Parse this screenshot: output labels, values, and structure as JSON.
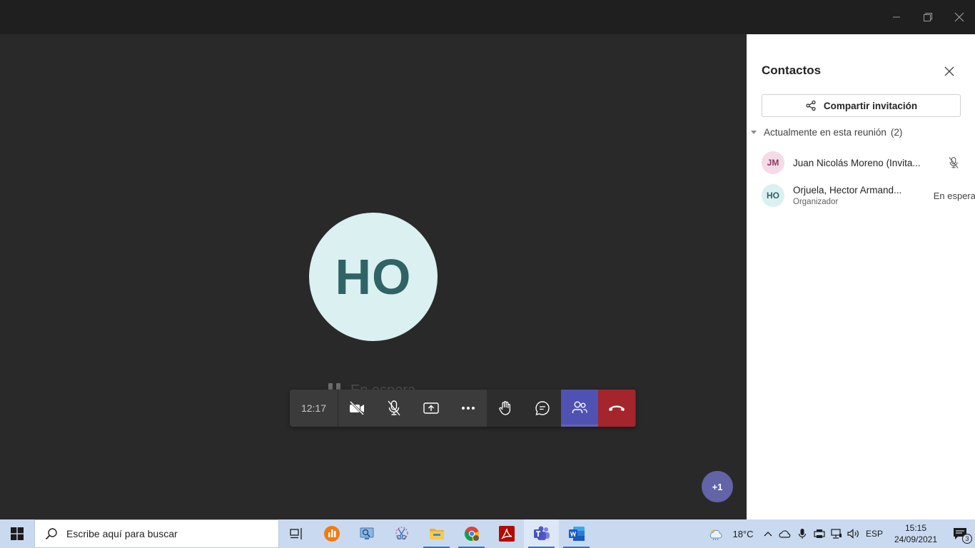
{
  "window": {
    "minimize_icon": "minimize-icon",
    "restore_icon": "restore-icon",
    "close_icon": "close-icon"
  },
  "stage": {
    "avatar_initials": "HO",
    "status_text": "En espera",
    "overflow_badge": "+1"
  },
  "toolbar": {
    "timer": "12:17",
    "buttons": [
      "camera-off-icon",
      "mic-off-icon",
      "share-screen-icon",
      "more-icon",
      "raise-hand-icon",
      "chat-icon",
      "participants-icon",
      "hang-up-icon"
    ]
  },
  "panel": {
    "title": "Contactos",
    "share_label": "Compartir invitación",
    "section_label": "Actualmente en esta reunión",
    "section_count": "(2)",
    "participants": [
      {
        "initials": "JM",
        "name": "Juan Nicolás Moreno (Invita...",
        "role": "",
        "status": "",
        "avatar_bg": "#f4dbe6",
        "avatar_fg": "#8f3a64"
      },
      {
        "initials": "HO",
        "name": "Orjuela, Hector Armand...",
        "role": "Organizador",
        "status": "En espera",
        "avatar_bg": "#daf0f1",
        "avatar_fg": "#2f6365"
      }
    ]
  },
  "taskbar": {
    "search_placeholder": "Escribe aquí para buscar",
    "weather_temp": "18°C",
    "language": "ESP",
    "time": "15:15",
    "date": "24/09/2021",
    "notification_count": "3"
  },
  "colors": {
    "accent": "#6264a7",
    "leave": "#a4262c",
    "stage_bg": "#292929",
    "taskbar_bg": "#c9daf0"
  }
}
